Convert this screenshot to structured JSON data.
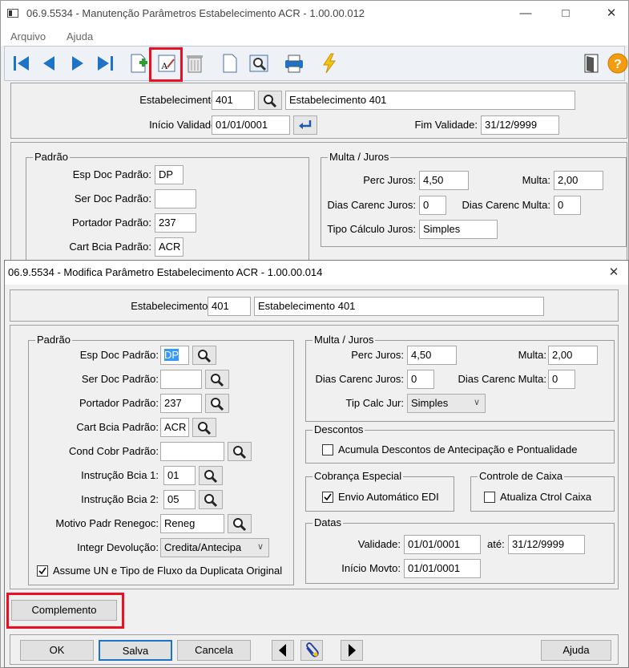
{
  "bg_window": {
    "title": "06.9.5534 - Manutenção Parâmetros Estabelecimento ACR - 1.00.00.012",
    "menu": [
      "Arquivo",
      "Ajuda"
    ],
    "header": {
      "estab_label": "Estabelecimento:",
      "estab_code": "401",
      "estab_name": "Estabelecimento 401",
      "inicio_label": "Início Validade:",
      "inicio_value": "01/01/0001",
      "fim_label": "Fim Validade:",
      "fim_value": "31/12/9999"
    },
    "padrao": {
      "title": "Padrão",
      "esp_label": "Esp Doc Padrão:",
      "esp_value": "DP",
      "ser_label": "Ser Doc Padrão:",
      "ser_value": "",
      "port_label": "Portador Padrão:",
      "port_value": "237",
      "cart_label": "Cart Bcia Padrão:",
      "cart_value": "ACR"
    },
    "multa": {
      "title": "Multa / Juros",
      "perc_label": "Perc Juros:",
      "perc_value": "4,50",
      "multa_label": "Multa:",
      "multa_value": "2,00",
      "dcj_label": "Dias Carenc Juros:",
      "dcj_value": "0",
      "dcm_label": "Dias Carenc Multa:",
      "dcm_value": "0",
      "tipo_label": "Tipo Cálculo Juros:",
      "tipo_value": "Simples"
    }
  },
  "dialog": {
    "title": "06.9.5534 - Modifica Parâmetro Estabelecimento ACR - 1.00.00.014",
    "close_glyph": "✕",
    "header": {
      "estab_label": "Estabelecimento:",
      "estab_code": "401",
      "estab_name": "Estabelecimento 401"
    },
    "padrao": {
      "title": "Padrão",
      "esp_label": "Esp Doc Padrão:",
      "esp_value": "DP",
      "ser_label": "Ser Doc Padrão:",
      "ser_value": "",
      "port_label": "Portador Padrão:",
      "port_value": "237",
      "cart_label": "Cart Bcia Padrão:",
      "cart_value": "ACR",
      "cond_label": "Cond Cobr Padrão:",
      "cond_value": "",
      "ib1_label": "Instrução Bcia 1:",
      "ib1_value": "01",
      "ib2_label": "Instrução Bcia 2:",
      "ib2_value": "05",
      "mot_label": "Motivo Padr Renegoc:",
      "mot_value": "Reneg",
      "integr_label": "Integr Devolução:",
      "integr_value": "Credita/Antecipa",
      "assume_label": "Assume UN e Tipo de Fluxo da Duplicata Original"
    },
    "multa": {
      "title": "Multa / Juros",
      "perc_label": "Perc Juros:",
      "perc_value": "4,50",
      "multa_label": "Multa:",
      "multa_value": "2,00",
      "dcj_label": "Dias Carenc Juros:",
      "dcj_value": "0",
      "dcm_label": "Dias Carenc Multa:",
      "dcm_value": "0",
      "tip_label": "Tip Calc Jur:",
      "tip_value": "Simples"
    },
    "descontos": {
      "title": "Descontos",
      "acumula_label": "Acumula Descontos de Antecipação e Pontualidade"
    },
    "cobranca": {
      "title": "Cobrança Especial",
      "envio_label": "Envio Automático EDI"
    },
    "controle": {
      "title": "Controle de Caixa",
      "atualiza_label": "Atualiza Ctrol Caixa"
    },
    "datas": {
      "title": "Datas",
      "validade_label": "Validade:",
      "validade_value": "01/01/0001",
      "ate_label": "até:",
      "ate_value": "31/12/9999",
      "inicio_label": "Início Movto:",
      "inicio_value": "01/01/0001"
    },
    "buttons": {
      "complemento": "Complemento",
      "ok": "OK",
      "salva": "Salva",
      "cancela": "Cancela",
      "ajuda": "Ajuda"
    }
  },
  "colors": {
    "highlight": "#e81123",
    "toolbar_blue": "#1e73c8",
    "help_orange": "#f39c12"
  }
}
